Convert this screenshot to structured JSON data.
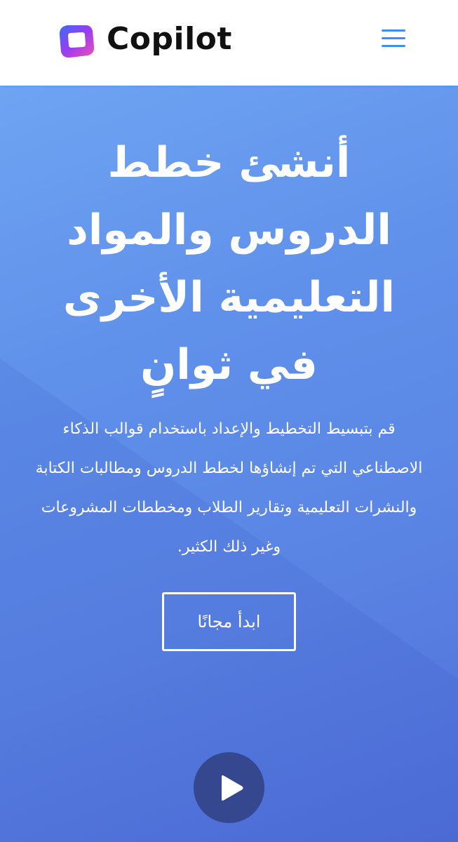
{
  "header": {
    "brand": "Copilot",
    "logo_icon": "copilot-logo-icon",
    "menu_icon": "hamburger-menu-icon",
    "accent_color": "#3d8ef0"
  },
  "hero": {
    "title_line_1": "أنشئ خطط",
    "title_line_2": "الدروس والمواد",
    "title_line_3": "التعليمية الأخرى",
    "title_line_4": "في ثوانٍ",
    "description": "قم بتبسيط التخطيط والإعداد باستخدام قوالب الذكاء الاصطناعي التي تم إنشاؤها لخطط الدروس ومطالبات الكتابة والنشرات التعليمية وتقارير الطلاب ومخططات المشروعات وغير ذلك الكثير.",
    "cta_label": "ابدأ مجانًا",
    "play_icon": "play-icon",
    "gradient_start": "#6ea4f2",
    "gradient_end": "#4f6fd8",
    "play_bg": "#34478f"
  }
}
